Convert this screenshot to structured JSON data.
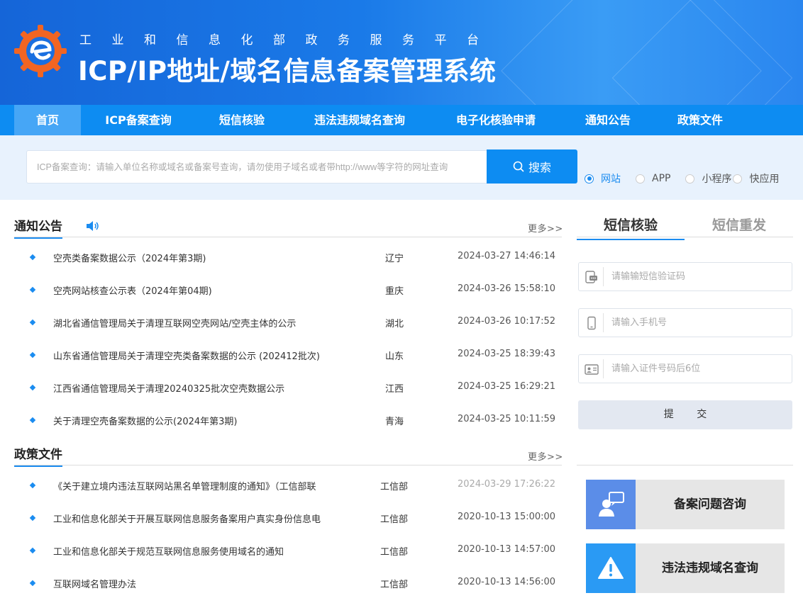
{
  "header": {
    "subtitle": "工业和信息化部政务服务平台",
    "title": "ICP/IP地址/域名信息备案管理系统"
  },
  "nav": {
    "items": [
      {
        "label": "首页",
        "active": true
      },
      {
        "label": "ICP备案查询"
      },
      {
        "label": "短信核验"
      },
      {
        "label": "违法违规域名查询"
      },
      {
        "label": "电子化核验申请"
      },
      {
        "label": "通知公告"
      },
      {
        "label": "政策文件"
      }
    ]
  },
  "search": {
    "placeholder": "ICP备案查询：请输入单位名称或域名或备案号查询，请勿使用子域名或者带http://www等字符的网址查询",
    "button_label": "搜索",
    "types": [
      {
        "label": "网站",
        "selected": true
      },
      {
        "label": "APP"
      },
      {
        "label": "小程序"
      },
      {
        "label": "快应用"
      }
    ]
  },
  "notices": {
    "title": "通知公告",
    "more": "更多>>",
    "items": [
      {
        "title": "空壳类备案数据公示（2024年第3期)",
        "region": "辽宁",
        "time": "2024-03-27 14:46:14"
      },
      {
        "title": "空壳网站核查公示表（2024年第04期)",
        "region": "重庆",
        "time": "2024-03-26 15:58:10"
      },
      {
        "title": "湖北省通信管理局关于清理互联网空壳网站/空壳主体的公示",
        "region": "湖北",
        "time": "2024-03-26 10:17:52"
      },
      {
        "title": "山东省通信管理局关于清理空壳类备案数据的公示 (202412批次)",
        "region": "山东",
        "time": "2024-03-25 18:39:43"
      },
      {
        "title": "江西省通信管理局关于清理20240325批次空壳数据公示",
        "region": "江西",
        "time": "2024-03-25 16:29:21"
      },
      {
        "title": "关于清理空壳备案数据的公示(2024年第3期)",
        "region": "青海",
        "time": "2024-03-25 10:11:59"
      }
    ]
  },
  "policies": {
    "title": "政策文件",
    "more": "更多>>",
    "items": [
      {
        "title": "《关于建立境内违法互联网站黑名单管理制度的通知》（工信部联",
        "region": "工信部",
        "time": "2024-03-29 17:26:22"
      },
      {
        "title": "工业和信息化部关于开展互联网信息服务备案用户真实身份信息电",
        "region": "工信部",
        "time": "2020-10-13 15:00:00"
      },
      {
        "title": "工业和信息化部关于规范互联网信息服务使用域名的通知",
        "region": "工信部",
        "time": "2020-10-13 14:57:00"
      },
      {
        "title": "互联网域名管理办法",
        "region": "工信部",
        "time": "2020-10-13 14:56:00"
      }
    ]
  },
  "sms": {
    "tab_verify": "短信核验",
    "tab_resend": "短信重发",
    "code_placeholder": "请输输短信验证码",
    "phone_placeholder": "请输入手机号",
    "id_placeholder": "请输入证件号码后6位",
    "submit_label": "提 交"
  },
  "quick": {
    "consult_label": "备案问题咨询",
    "illegal_label": "违法违规域名查询"
  },
  "colors": {
    "accent": "#0d8cf2",
    "consult_icon_bg": "#5b8de8",
    "illegal_icon_bg": "#2a9af4"
  }
}
